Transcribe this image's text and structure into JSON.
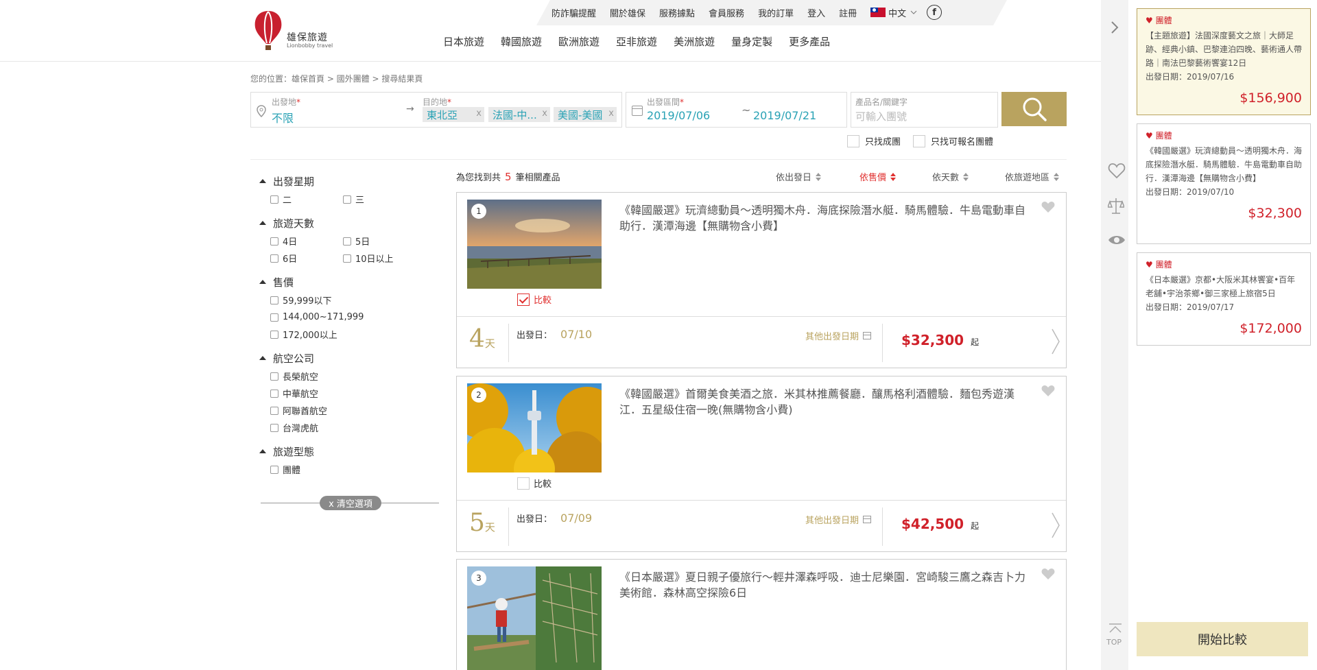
{
  "brand": {
    "name_zh": "雄保旅遊",
    "name_en": "Lionbobby travel"
  },
  "topbar": {
    "links": [
      "防詐騙提醒",
      "關於雄保",
      "服務據點",
      "會員服務",
      "我的訂單",
      "登入",
      "註冊"
    ],
    "language": "中文",
    "facebook": "f"
  },
  "nav": [
    "日本旅遊",
    "韓國旅遊",
    "歐洲旅遊",
    "亞非旅遊",
    "美洲旅遊",
    "量身定製",
    "更多產品"
  ],
  "breadcrumb": "您的位置：雄保首頁 > 國外團體 > 搜尋結果頁",
  "search": {
    "origin_label": "出發地",
    "origin_value": "不限",
    "dest_label": "目的地",
    "dest_tags": [
      "東北亞",
      "法國-中...",
      "美國-美國"
    ],
    "date_label": "出發區間",
    "date_from": "2019/07/06",
    "date_sep": "~",
    "date_to": "2019/07/21",
    "keyword_label": "產品名/關鍵字",
    "keyword_placeholder": "可輸入團號",
    "opt1": "只找成團",
    "opt2": "只找可報名團體",
    "required": "*"
  },
  "filters": {
    "weekday": {
      "title": "出發星期",
      "items": [
        "二",
        "三"
      ]
    },
    "days": {
      "title": "旅遊天數",
      "items": [
        "4日",
        "5日",
        "6日",
        "10日以上"
      ]
    },
    "price": {
      "title": "售價",
      "items": [
        "59,999以下",
        "144,000~171,999",
        "172,000以上"
      ]
    },
    "airline": {
      "title": "航空公司",
      "items": [
        "長榮航空",
        "中華航空",
        "阿聯酋航空",
        "台灣虎航"
      ]
    },
    "type": {
      "title": "旅遊型態",
      "items": [
        "團體"
      ]
    },
    "clear": "x 清空選項"
  },
  "results": {
    "count_prefix": "為您找到共",
    "count": "5",
    "count_suffix": "筆相關產品",
    "sort": [
      "依出發日",
      "依售價",
      "依天數",
      "依旅遊地區"
    ]
  },
  "products": [
    {
      "num": "1",
      "title": "《韓國嚴選》玩濟總動員～透明獨木舟．海底探險潛水艇．騎馬體驗．牛島電動車自助行．漢潭海邊【無購物含小費】",
      "compare": "比較",
      "days": "4",
      "days_unit": "天",
      "dep_label": "出發日：",
      "dep_date": "07/10",
      "other": "其他出發日期",
      "price": "$32,300",
      "price_suffix": "起"
    },
    {
      "num": "2",
      "title": "《韓國嚴選》首爾美食美酒之旅．米其林推薦餐廳．釀馬格利酒體驗．麵包秀遊漢江．五星級住宿一晚(無購物含小費)",
      "compare": "比較",
      "days": "5",
      "days_unit": "天",
      "dep_label": "出發日：",
      "dep_date": "07/09",
      "other": "其他出發日期",
      "price": "$42,500",
      "price_suffix": "起"
    },
    {
      "num": "3",
      "title": "《日本嚴選》夏日親子優旅行～輕井澤森呼吸．迪士尼樂園．宮崎駿三鷹之森吉卜力美術館．森林高空探險6日"
    }
  ],
  "side": {
    "top_label": "TOP"
  },
  "recent": [
    {
      "badge": "團體",
      "title": "【主題旅遊】法國深度藝文之旅｜大師足跡、經典小鎮、巴黎連泊四晚、藝術通人帶路｜南法巴黎藝術饗宴12日",
      "date": "出發日期：2019/07/16",
      "price": "$156,900"
    },
    {
      "badge": "團體",
      "title": "《韓國嚴選》玩濟總動員～透明獨木舟．海底探險潛水艇．騎馬體驗．牛島電動車自助行．漢潭海邊【無購物含小費】",
      "date": "出發日期：2019/07/10",
      "price": "$32,300"
    },
    {
      "badge": "團體",
      "title": "《日本嚴選》京都•大阪米其林饗宴•百年老舖•宇治茶鄉•御三家極上旅宿5日",
      "date": "出發日期：2019/07/17",
      "price": "$172,000"
    }
  ],
  "compare_button": "開始比較",
  "colors": {
    "gold": "#b9a35f",
    "red": "#d0212a",
    "teal": "#2aa2b5"
  }
}
